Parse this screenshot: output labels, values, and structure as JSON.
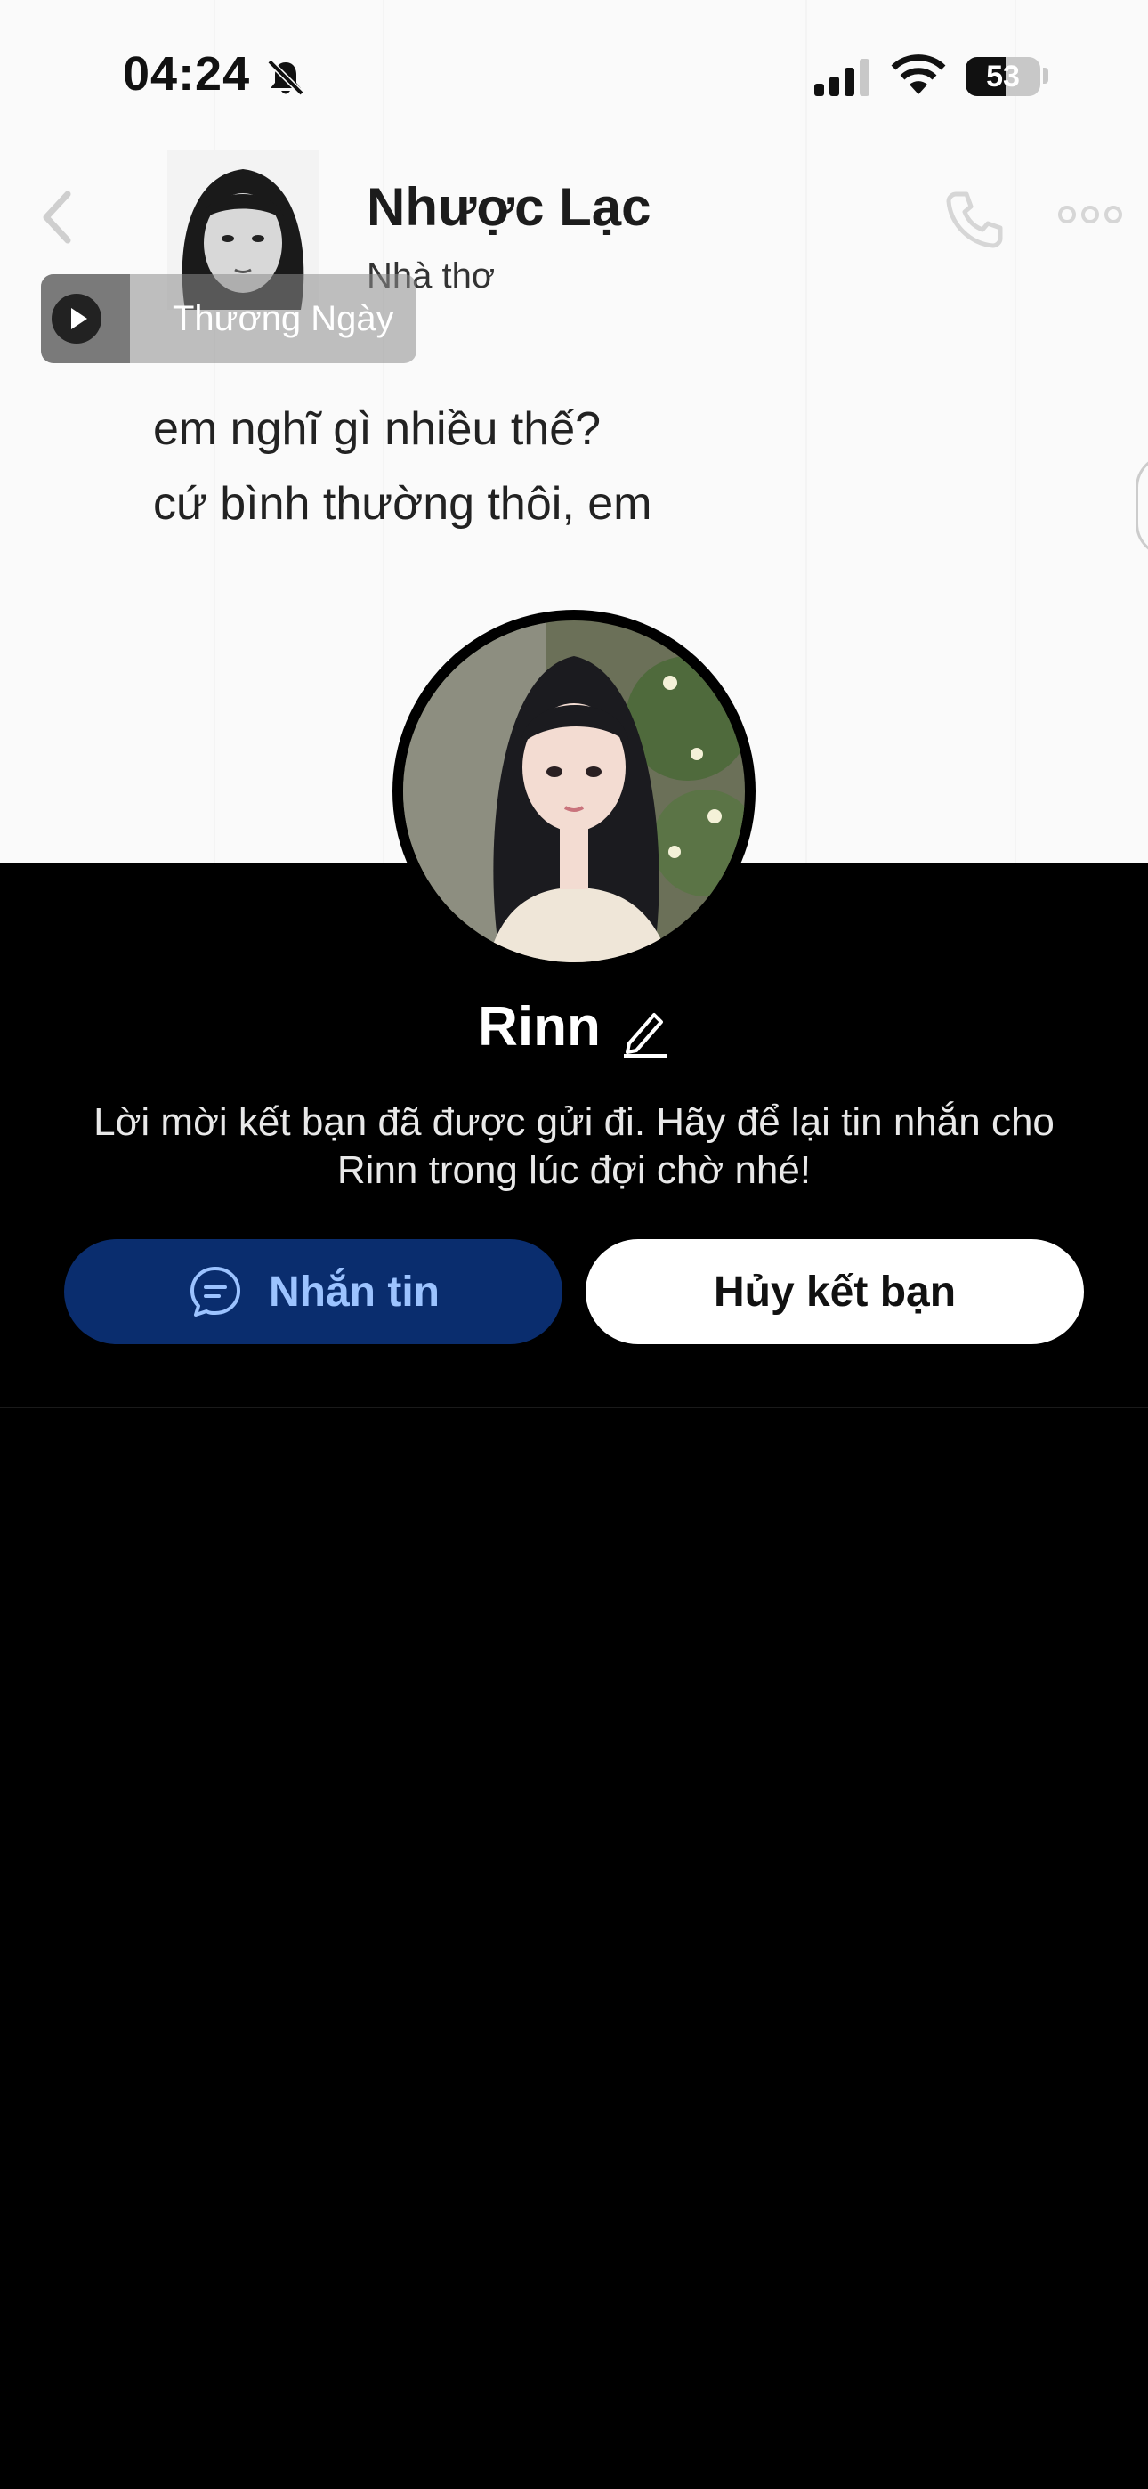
{
  "status_bar": {
    "time": "04:24",
    "battery_level": "53",
    "battery_fraction": 0.53
  },
  "cover": {
    "poet_name": "Nhược Lạc",
    "poet_subtitle": "Nhà thơ",
    "poem_lines": [
      "em nghĩ gì nhiều thế?",
      "cứ bình thường thôi, em"
    ],
    "music": {
      "song_title": "Thương Ngày"
    }
  },
  "profile": {
    "name": "Rinn",
    "info_text": "Lời mời kết bạn đã được gửi đi. Hãy để lại tin nhắn cho Rinn trong lúc đợi chờ nhé!",
    "message_button": "Nhắn tin",
    "unfriend_button": "Hủy kết bạn"
  },
  "colors": {
    "message_button_bg": "#0a2d6e",
    "message_button_text": "#9cc3ff",
    "background": "#000000"
  },
  "icons": [
    "bell-off-icon",
    "signal-icon",
    "wifi-icon",
    "battery-icon",
    "back-chevron-icon",
    "phone-icon",
    "more-icon",
    "play-icon",
    "edit-pencil-icon",
    "chat-bubble-icon"
  ]
}
